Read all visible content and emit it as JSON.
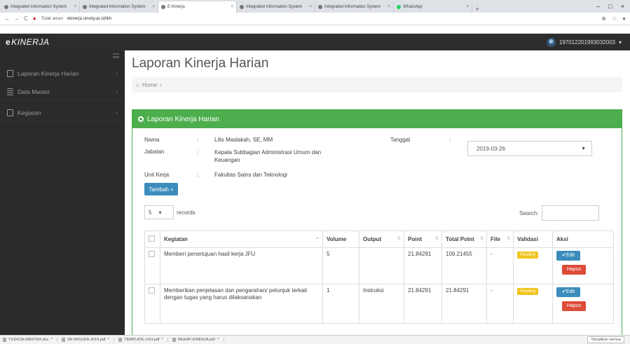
{
  "browser": {
    "tabs": [
      {
        "title": "Integrated Information System",
        "active": false
      },
      {
        "title": "Integrated Information System",
        "active": false
      },
      {
        "title": "E-Kinerja",
        "active": true
      },
      {
        "title": "Integrated Information System",
        "active": false
      },
      {
        "title": "Integrated Information System",
        "active": false
      },
      {
        "title": "WhatsApp",
        "active": false
      }
    ],
    "new_tab": "+",
    "nav_back": "←",
    "nav_forward": "→",
    "reload": "C",
    "security": "Tidak aman",
    "url": "ekinerja.uinsby.ac.id/lkh",
    "window_controls": [
      "–",
      "□",
      "×"
    ]
  },
  "header": {
    "brand": "KINERJA",
    "brand_mark": "e",
    "username": "197012201993032003"
  },
  "sidebar": {
    "items": [
      {
        "label": "Laporan Kinerja Harian",
        "icon": "file-icon"
      },
      {
        "label": "Data Master",
        "icon": "table-icon"
      },
      {
        "label": "Kegiatan",
        "icon": "file-icon"
      }
    ]
  },
  "main": {
    "title": "Laporan Kinerja Harian",
    "breadcrumb": "Home",
    "panel_title": "Laporan Kinerja Harian",
    "fields": {
      "nama_label": "Nama",
      "nama_value": "Lilis Maslakah, SE, MM",
      "jabatan_label": "Jabatan",
      "jabatan_value": "Kepala Subbagian Administrasi Umum dan Keuangan",
      "unit_label": "Unit Kerja",
      "unit_value": "Fakultas Sains dan Teknologi",
      "tanggal_label": "Tanggal",
      "tanggal_value": "2019-03-26",
      "colon": ":"
    },
    "tambah_button": "Tambah",
    "records_value": "5",
    "records_label": "records",
    "search_label": "Search:",
    "table": {
      "headers": [
        "Kegiatan",
        "Volume",
        "Output",
        "Point",
        "Total Point",
        "File",
        "Validasi",
        "Aksi"
      ],
      "rows": [
        {
          "kegiatan": "Memberi persetujuan hasil kerja JFU",
          "volume": "5",
          "output": "",
          "point": "21.84291",
          "total_point": "109.21455",
          "file": "-",
          "validasi": "Pending"
        },
        {
          "kegiatan": "Memberikan penjelasan dan pengarahan/ petunjuk terkait dengan tugas yang harus dilaksanakan",
          "volume": "1",
          "output": "Instruksi",
          "point": "21.84291",
          "total_point": "21.84291",
          "file": "-",
          "validasi": "Pending"
        }
      ],
      "edit_label": "Edit",
      "hapus_label": "Hapus"
    }
  },
  "downloads": {
    "items": [
      "YUDICIA-MASTER.doc",
      "SK-WISUDA-2019.pdf",
      "TEMPLATE-LKH.pdf",
      "REKAP-KINERJA.pdf"
    ],
    "show_all": "Tampilkan semua"
  },
  "colors": {
    "accent_green": "#4cae4c",
    "primary_blue": "#3c8dbc",
    "danger_red": "#dd4b39",
    "pending_yellow": "#f0c419",
    "dark_bg": "#2d2d2d"
  }
}
